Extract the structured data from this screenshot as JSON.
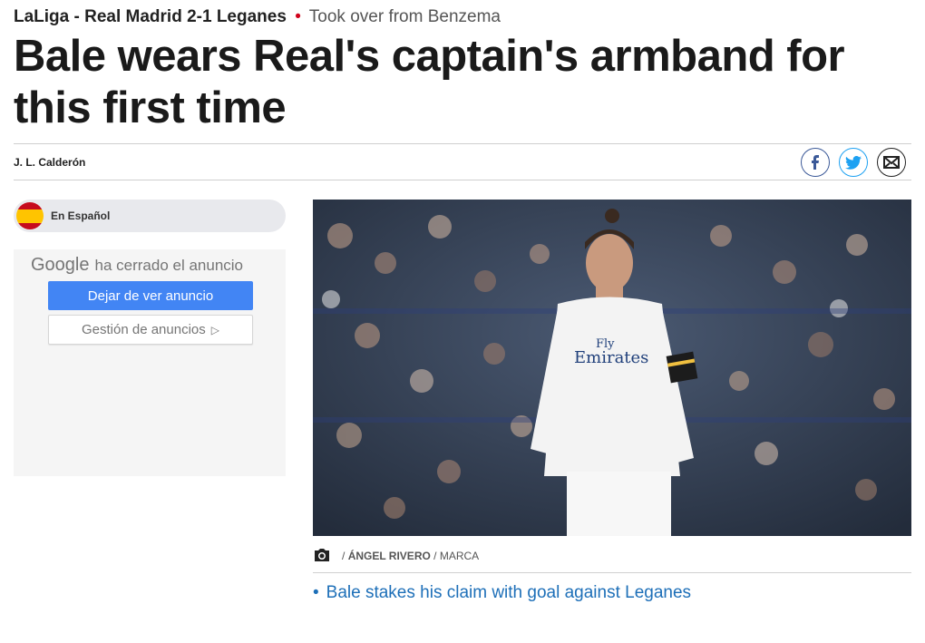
{
  "kicker": {
    "section": "LaLiga - Real Madrid 2-1 Leganes",
    "separator": "•",
    "subtitle": "Took over from Benzema"
  },
  "headline": "Bale wears Real's captain's armband for this first time",
  "byline": {
    "author": "J. L. Calderón"
  },
  "share": {
    "icons": [
      "facebook-icon",
      "twitter-icon",
      "mail-icon"
    ]
  },
  "language": {
    "label": "En Español",
    "flag": "spain-flag-icon"
  },
  "ad": {
    "brand": "Google",
    "message": "ha cerrado el anuncio",
    "stop_label": "Dejar de ver anuncio",
    "manage_label": "Gestión de anuncios",
    "manage_icon": "▷"
  },
  "photo": {
    "caption_author": "ÁNGEL RIVERO",
    "caption_source": "MARCA",
    "caption_sep": "/"
  },
  "related": {
    "bullet": "•",
    "link": "Bale stakes his claim with goal against Leganes"
  },
  "colors": {
    "accent_red": "#d0021b",
    "link_blue": "#1d6fb8",
    "ad_blue": "#4285f4",
    "facebook": "#3b5998",
    "twitter": "#1da1f2"
  }
}
